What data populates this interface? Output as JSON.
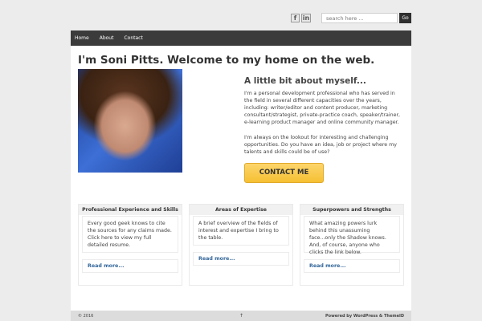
{
  "social": {
    "facebook": "f",
    "linkedin": "in"
  },
  "search": {
    "placeholder": "search here ...",
    "button": "Go"
  },
  "nav": {
    "items": [
      "Home",
      "About",
      "Contact"
    ]
  },
  "main": {
    "title": "I'm Soni Pitts. Welcome to my home on the web.",
    "about_heading": "A little bit about myself...",
    "about_p1": "I'm a personal development professional who has served in the field in several different capacities over the years, including: writer/editor and content producer, marketing consultant/strategist, private-practice coach, speaker/trainer, e-learning product manager and online community manager.",
    "about_p2": "I'm always on the lookout for interesting and challenging opportunities. Do you have an idea, job or project where my talents and skills could be of use?",
    "contact_button": "CONTACT ME"
  },
  "columns": [
    {
      "heading": "Professional Experience and Skills",
      "text": "Every good geek knows to cite the sources for any claims made. Click here to view my full detailed resume.",
      "more": "Read more..."
    },
    {
      "heading": "Areas of Expertise",
      "text": "A brief overview of the fields of interest and expertise I bring to the table.",
      "more": "Read more..."
    },
    {
      "heading": "Superpowers and Strengths",
      "text": "What amazing powers lurk behind this unassuming face...only the Shadow knows. And, of course, anyone who clicks the link below.",
      "more": "Read more..."
    }
  ],
  "footer": {
    "copyright": "© 2016",
    "top": "↑",
    "credit": "Powered by WordPress & ThemeID"
  }
}
